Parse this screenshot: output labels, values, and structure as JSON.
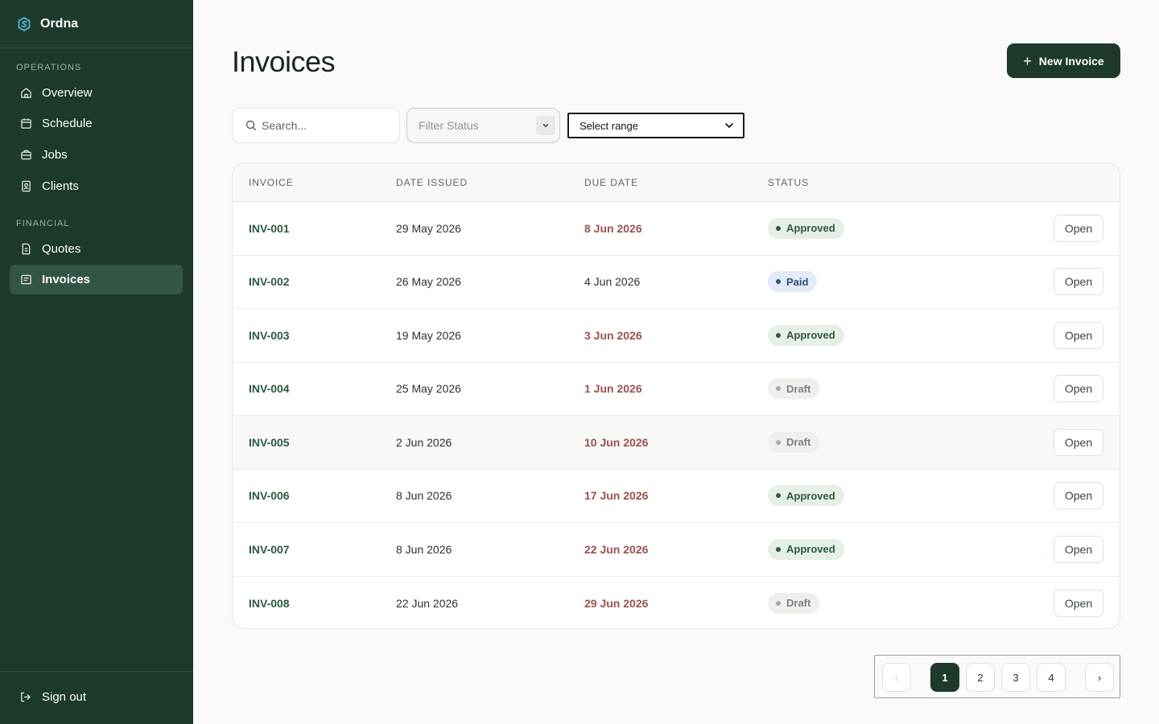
{
  "brand": {
    "name": "Ordna"
  },
  "sidebar": {
    "sections": [
      {
        "label": "OPERATIONS"
      },
      {
        "label": "FINANCIAL"
      }
    ],
    "items": [
      {
        "label": "Overview",
        "icon": "home-icon"
      },
      {
        "label": "Schedule",
        "icon": "calendar-icon"
      },
      {
        "label": "Jobs",
        "icon": "briefcase-icon"
      },
      {
        "label": "Clients",
        "icon": "contacts-icon"
      },
      {
        "label": "Quotes",
        "icon": "document-icon"
      },
      {
        "label": "Invoices",
        "icon": "invoice-icon",
        "active": true
      }
    ],
    "signout": {
      "label": "Sign out",
      "icon": "logout-icon"
    }
  },
  "page": {
    "title": "Invoices"
  },
  "toolbar": {
    "new_button": "New Invoice",
    "search_placeholder": "Search...",
    "filter_status": "Filter Status",
    "select_range": "Select range"
  },
  "table": {
    "columns": [
      "INVOICE",
      "DATE ISSUED",
      "DUE DATE",
      "STATUS"
    ],
    "action_label": "Open",
    "rows": [
      {
        "invoice": "INV-001",
        "issued": "29 May 2026",
        "due": "8 Jun 2026",
        "due_overdue": true,
        "status": "Approved"
      },
      {
        "invoice": "INV-002",
        "issued": "26 May 2026",
        "due": "4 Jun 2026",
        "due_overdue": false,
        "status": "Paid"
      },
      {
        "invoice": "INV-003",
        "issued": "19 May 2026",
        "due": "3 Jun 2026",
        "due_overdue": true,
        "status": "Approved"
      },
      {
        "invoice": "INV-004",
        "issued": "25 May 2026",
        "due": "1 Jun 2026",
        "due_overdue": true,
        "status": "Draft"
      },
      {
        "invoice": "INV-005",
        "issued": "2 Jun 2026",
        "due": "10 Jun 2026",
        "due_overdue": true,
        "status": "Draft"
      },
      {
        "invoice": "INV-006",
        "issued": "8 Jun 2026",
        "due": "17 Jun 2026",
        "due_overdue": true,
        "status": "Approved"
      },
      {
        "invoice": "INV-007",
        "issued": "8 Jun 2026",
        "due": "22 Jun 2026",
        "due_overdue": true,
        "status": "Approved"
      },
      {
        "invoice": "INV-008",
        "issued": "22 Jun 2026",
        "due": "29 Jun 2026",
        "due_overdue": true,
        "status": "Draft"
      }
    ]
  },
  "pagination": {
    "prev": "‹",
    "next": "›",
    "pages": [
      "1",
      "2",
      "3",
      "4"
    ],
    "current": "1"
  },
  "colors": {
    "sidebar_bg": "#1d3a2b",
    "accent": "#1d3a2b",
    "invoice_link": "#2d5a40",
    "overdue": "#9c5150",
    "approved": "#2d5a40",
    "paid": "#2f4f7a",
    "draft": "#7d827e"
  }
}
